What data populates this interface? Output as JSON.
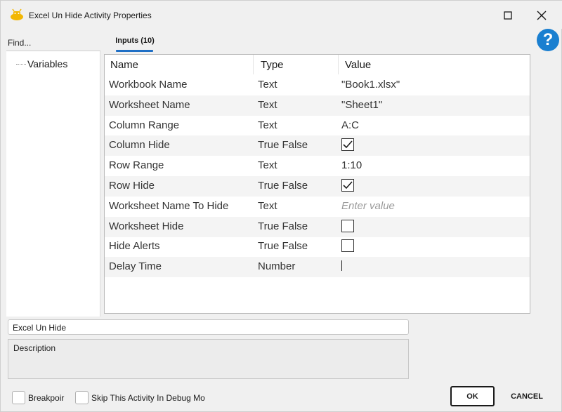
{
  "window": {
    "title": "Excel Un Hide Activity Properties",
    "help_label": "?"
  },
  "left_panel": {
    "find_label": "Find...",
    "tree_item": "Variables"
  },
  "tabs": [
    {
      "label": "Inputs (10)",
      "active": true
    }
  ],
  "grid": {
    "columns": [
      "Name",
      "Type",
      "Value"
    ],
    "rows": [
      {
        "name": "Workbook Name",
        "type": "Text",
        "value": "\"Book1.xlsx\"",
        "kind": "text"
      },
      {
        "name": "Worksheet Name",
        "type": "Text",
        "value": "\"Sheet1\"",
        "kind": "text"
      },
      {
        "name": "Column Range",
        "type": "Text",
        "value": "A:C",
        "kind": "text"
      },
      {
        "name": "Column Hide",
        "type": "True False",
        "value": "",
        "kind": "checkbox",
        "checked": true
      },
      {
        "name": "Row Range",
        "type": "Text",
        "value": "1:10",
        "kind": "text"
      },
      {
        "name": "Row Hide",
        "type": "True False",
        "value": "",
        "kind": "checkbox",
        "checked": true
      },
      {
        "name": "Worksheet Name To Hide",
        "type": "Text",
        "value": "Enter value",
        "kind": "placeholder"
      },
      {
        "name": "Worksheet Hide",
        "type": "True False",
        "value": "",
        "kind": "checkbox",
        "checked": false
      },
      {
        "name": "Hide Alerts",
        "type": "True False",
        "value": "",
        "kind": "checkbox",
        "checked": false
      },
      {
        "name": "Delay Time",
        "type": "Number",
        "value": "",
        "kind": "caret"
      }
    ]
  },
  "activity_name": "Excel Un Hide",
  "description_label": "Description",
  "footer": {
    "breakpoint_label": "Breakpoir",
    "skip_label": "Skip This Activity In Debug Mo",
    "ok_label": "OK",
    "cancel_label": "CANCEL"
  },
  "colors": {
    "accent": "#1f6fc5",
    "help": "#1a7fd0"
  }
}
